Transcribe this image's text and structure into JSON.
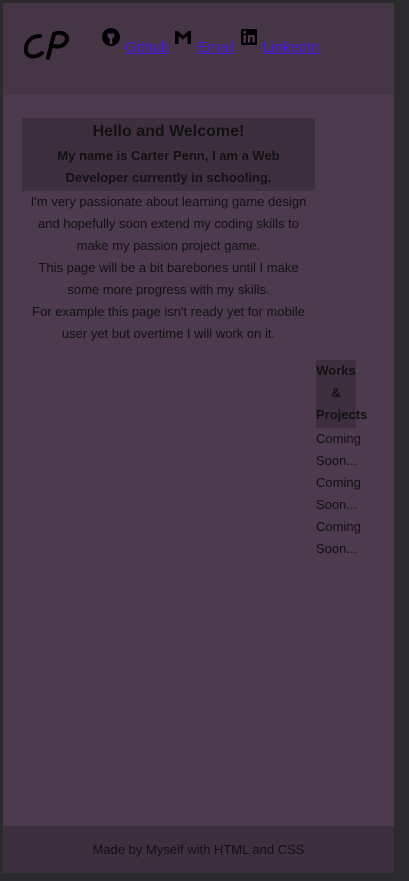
{
  "header": {
    "logo_alt": "CP logo",
    "nav": [
      {
        "label": "Github",
        "icon": "github-icon"
      },
      {
        "label": "Email",
        "icon": "gmail-icon"
      },
      {
        "label": "LinkedIn",
        "icon": "linkedin-icon"
      }
    ]
  },
  "hero": {
    "title": "Hello and Welcome!",
    "subtitle": "My name is Carter Penn, I am a Web Developer currently in schooling.",
    "paragraphs": [
      "I'm very passionate about learning game design and hopefully soon extend my coding skills to make my passion project game.",
      "This page will be a bit barebones until I make some more progress with my skills.",
      "For example this page isn't ready yet for mobile user yet but overtime I will work on it."
    ]
  },
  "works": {
    "title": "Works & Projects",
    "items": [
      "Coming Soon...",
      "Coming Soon...",
      "Coming Soon..."
    ]
  },
  "footer": {
    "text": "Made by Myself with HTML and CSS"
  },
  "colors": {
    "page_bg": "#4e3a4e",
    "header_bg": "#453545",
    "box_bg": "#3e2f3e",
    "link": "#4b1ae8"
  }
}
